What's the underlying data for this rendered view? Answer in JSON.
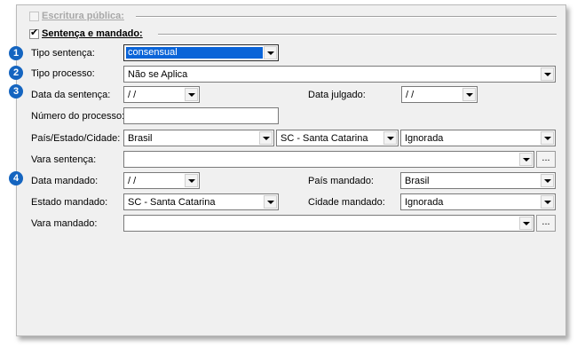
{
  "group_escritura": {
    "label": "Escritura pública:",
    "checked": false
  },
  "group_sentenca": {
    "label": "Sentença e mandado:",
    "checked": true
  },
  "badges": [
    "1",
    "2",
    "3",
    "4"
  ],
  "fields": {
    "tipo_sentenca": {
      "label": "Tipo sentença:",
      "value": "consensual"
    },
    "tipo_processo": {
      "label": "Tipo processo:",
      "value": "Não se Aplica"
    },
    "data_sentenca": {
      "label": "Data da sentença:",
      "value": " /  /"
    },
    "data_julgado": {
      "label": "Data julgado:",
      "value": " /  /"
    },
    "numero_processo": {
      "label": "Número do processo:",
      "value": ""
    },
    "pais_estado_cidade": {
      "label": "País/Estado/Cidade:",
      "pais": "Brasil",
      "estado": "SC - Santa Catarina",
      "cidade": "Ignorada"
    },
    "vara_sentenca": {
      "label": "Vara sentença:",
      "value": ""
    },
    "data_mandado": {
      "label": "Data mandado:",
      "value": " /  /"
    },
    "pais_mandado": {
      "label": "País mandado:",
      "value": "Brasil"
    },
    "estado_mandado": {
      "label": "Estado mandado:",
      "value": "SC - Santa Catarina"
    },
    "cidade_mandado": {
      "label": "Cidade mandado:",
      "value": "Ignorada"
    },
    "vara_mandado": {
      "label": "Vara mandado:",
      "value": ""
    }
  },
  "ellipsis_label": "...",
  "colors": {
    "badge": "#1565c0",
    "selection": "#0a64d8",
    "panel": "#f0f0f0"
  }
}
